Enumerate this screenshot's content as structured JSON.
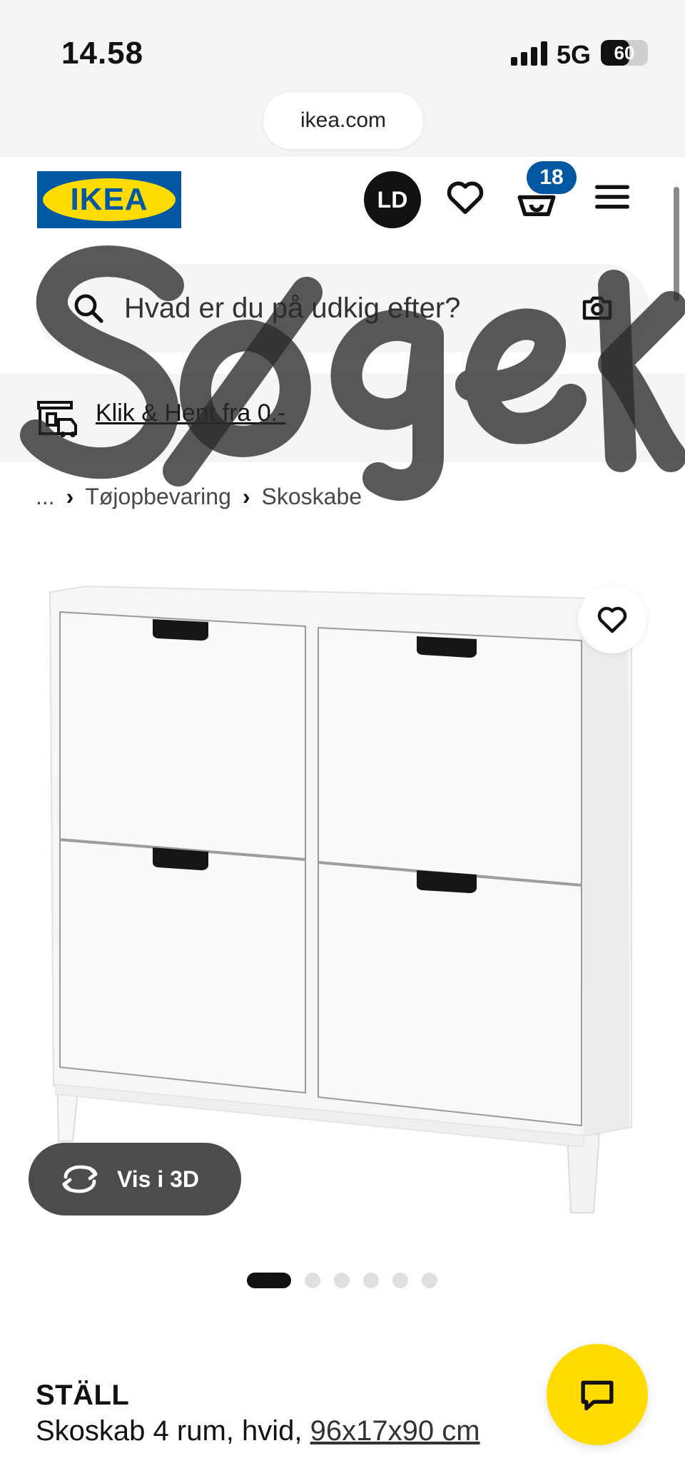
{
  "status_bar": {
    "time": "14.58",
    "network": "5G",
    "battery": "60",
    "battery_level": 0.6
  },
  "browser": {
    "url": "ikea.com"
  },
  "header": {
    "logo_text": "IKEA",
    "avatar_initials": "LD",
    "cart_count": "18",
    "icons": [
      "heart-icon",
      "basket-icon",
      "menu-icon"
    ]
  },
  "search": {
    "placeholder": "Hvad er du på udkig efter?",
    "icons": [
      "search-icon",
      "camera-icon"
    ]
  },
  "overlay": {
    "handwriting": "Søger"
  },
  "click_collect": {
    "label": "Klik & Hent fra 0.-"
  },
  "breadcrumb": {
    "ellipsis": "...",
    "items": [
      "Tøjopbevaring",
      "Skoskabe"
    ]
  },
  "product_image": {
    "view_3d_label": "Vis i 3D",
    "dots_total": 6,
    "active_dot": 0
  },
  "product": {
    "name": "STÄLL",
    "description": "Skoskab 4 rum, hvid,",
    "dimensions": "96x17x90 cm"
  },
  "colors": {
    "ikea_blue": "#0058a3",
    "ikea_yellow": "#ffdb00",
    "dark_pill": "#4c4c4c"
  }
}
